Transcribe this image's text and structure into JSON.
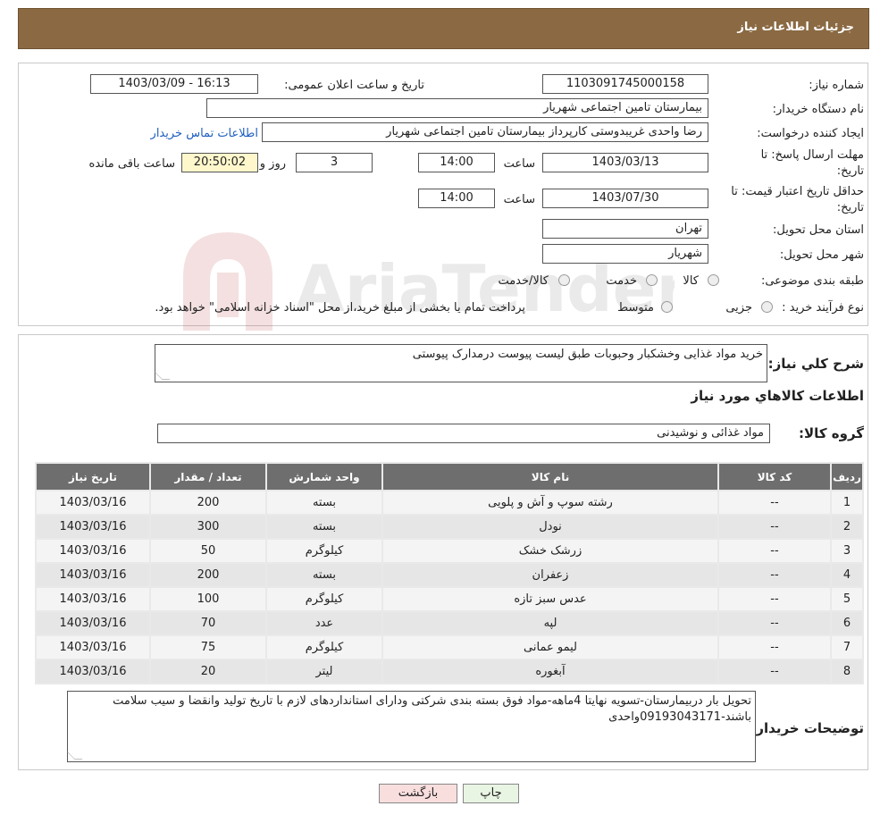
{
  "header": {
    "title": "جزئیات اطلاعات نیاز"
  },
  "watermark": {
    "text": "AriaTender.neT"
  },
  "form": {
    "need_number_label": "شماره نیاز:",
    "need_number": "1103091745000158",
    "announce_label": "تاریخ و ساعت اعلان عمومی:",
    "announce_value": "1403/03/09 - 16:13",
    "buyer_org_label": "نام دستگاه خریدار:",
    "buyer_org": "بیمارستان تامین اجتماعی شهریار",
    "creator_label": "ایجاد کننده درخواست:",
    "creator": "رضا واحدی غریبدوستی کارپرداز بیمارستان تامین اجتماعی شهریار",
    "contact_link": "اطلاعات تماس خریدار",
    "reply_deadline_label_1": "مهلت ارسال پاسخ: تا",
    "reply_deadline_label_2": "تاریخ:",
    "reply_date": "1403/03/13",
    "time_label": "ساعت",
    "reply_time": "14:00",
    "days_value": "3",
    "days_label": "روز و",
    "remaining_time": "20:50:02",
    "remaining_label": "ساعت باقی مانده",
    "validity_label_1": "حداقل تاریخ اعتبار قیمت: تا",
    "validity_label_2": "تاریخ:",
    "validity_date": "1403/07/30",
    "validity_time": "14:00",
    "province_label": "استان محل تحویل:",
    "province": "تهران",
    "city_label": "شهر محل تحویل:",
    "city": "شهریار",
    "category_label": "طبقه بندی موضوعی:",
    "category_options": [
      "کالا",
      "خدمت",
      "کالا/خدمت"
    ],
    "process_label": "نوع فرآیند خرید :",
    "process_options": [
      "جزیی",
      "متوسط"
    ],
    "process_note": "پرداخت تمام یا بخشی از مبلغ خرید،از محل \"اسناد خزانه اسلامی\" خواهد بود."
  },
  "details": {
    "summary_label": "شرح کلي نياز:",
    "summary": "خرید مواد غذایی وخشکبار وحبوبات طبق لیست پیوست درمدارک پیوستی",
    "goods_title": "اطلاعات کالاهاي مورد نياز",
    "group_label": "گروه کالا:",
    "group_value": "مواد غذائی و نوشیدنی"
  },
  "table": {
    "headers": [
      "رديف",
      "کد کالا",
      "نام کالا",
      "واحد شمارش",
      "تعداد / مقدار",
      "تاريخ نياز"
    ],
    "rows": [
      [
        "1",
        "--",
        "رشته سوپ و آش و پلویی",
        "بسته",
        "200",
        "1403/03/16"
      ],
      [
        "2",
        "--",
        "نودل",
        "بسته",
        "300",
        "1403/03/16"
      ],
      [
        "3",
        "--",
        "زرشک خشک",
        "کیلوگرم",
        "50",
        "1403/03/16"
      ],
      [
        "4",
        "--",
        "زعفران",
        "بسته",
        "200",
        "1403/03/16"
      ],
      [
        "5",
        "--",
        "عدس سبز تازه",
        "کیلوگرم",
        "100",
        "1403/03/16"
      ],
      [
        "6",
        "--",
        "لپه",
        "عدد",
        "70",
        "1403/03/16"
      ],
      [
        "7",
        "--",
        "لیمو عمانی",
        "کیلوگرم",
        "75",
        "1403/03/16"
      ],
      [
        "8",
        "--",
        "آبغوره",
        "لیتر",
        "20",
        "1403/03/16"
      ]
    ]
  },
  "notes": {
    "label": "توضیحات خریدار:",
    "text": "تحویل بار دربیمارستان-تسویه نهایتا 4ماهه-مواد فوق بسته بندی شرکتی ودارای استانداردهای لازم با تاریخ تولید وانقضا و سیب سلامت باشند-09193043171واحدی"
  },
  "buttons": {
    "print": "چاپ",
    "back": "بازگشت"
  },
  "colors": {
    "header_bg": "#8b6a43",
    "table_header_bg": "#6e6e6e",
    "print_btn_bg": "#e9f5e3",
    "back_btn_bg": "#f9dede"
  }
}
